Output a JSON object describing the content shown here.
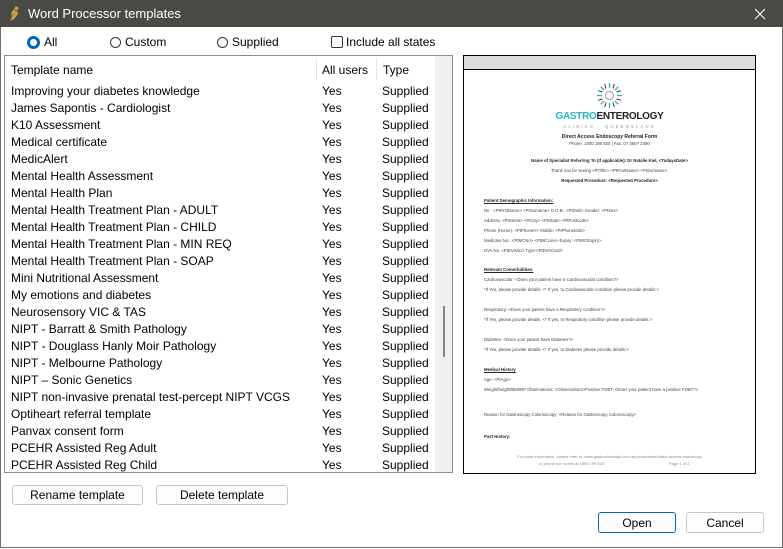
{
  "window": {
    "title": "Word Processor templates",
    "app_icon": "finch-bird-icon",
    "close_icon": "close-icon"
  },
  "filters": {
    "options": [
      {
        "label": "All",
        "checked": true
      },
      {
        "label": "Custom",
        "checked": false
      },
      {
        "label": "Supplied",
        "checked": false
      }
    ],
    "include_all_states": {
      "label": "Include all states",
      "checked": false
    }
  },
  "table": {
    "columns": [
      "Template name",
      "All users",
      "Type"
    ],
    "rows": [
      {
        "name": "Improving your diabetes knowledge",
        "all_users": "Yes",
        "type": "Supplied"
      },
      {
        "name": "James Sapontis - Cardiologist",
        "all_users": "Yes",
        "type": "Supplied"
      },
      {
        "name": "K10 Assessment",
        "all_users": "Yes",
        "type": "Supplied"
      },
      {
        "name": "Medical certificate",
        "all_users": "Yes",
        "type": "Supplied"
      },
      {
        "name": "MedicAlert",
        "all_users": "Yes",
        "type": "Supplied"
      },
      {
        "name": "Mental Health Assessment",
        "all_users": "Yes",
        "type": "Supplied"
      },
      {
        "name": "Mental Health Plan",
        "all_users": "Yes",
        "type": "Supplied"
      },
      {
        "name": "Mental Health Treatment Plan - ADULT",
        "all_users": "Yes",
        "type": "Supplied"
      },
      {
        "name": "Mental Health Treatment Plan - CHILD",
        "all_users": "Yes",
        "type": "Supplied"
      },
      {
        "name": "Mental Health Treatment Plan - MIN REQ",
        "all_users": "Yes",
        "type": "Supplied"
      },
      {
        "name": "Mental Health Treatment Plan - SOAP",
        "all_users": "Yes",
        "type": "Supplied"
      },
      {
        "name": "Mini Nutritional Assessment",
        "all_users": "Yes",
        "type": "Supplied"
      },
      {
        "name": "My emotions and diabetes",
        "all_users": "Yes",
        "type": "Supplied"
      },
      {
        "name": "Neurosensory VIC & TAS",
        "all_users": "Yes",
        "type": "Supplied"
      },
      {
        "name": "NIPT - Barratt & Smith Pathology",
        "all_users": "Yes",
        "type": "Supplied"
      },
      {
        "name": "NIPT - Douglass Hanly Moir Pathology",
        "all_users": "Yes",
        "type": "Supplied"
      },
      {
        "name": "NIPT - Melbourne Pathology",
        "all_users": "Yes",
        "type": "Supplied"
      },
      {
        "name": "NIPT – Sonic Genetics",
        "all_users": "Yes",
        "type": "Supplied"
      },
      {
        "name": "NIPT non-invasive prenatal test-percept NIPT VCGS",
        "all_users": "Yes",
        "type": "Supplied"
      },
      {
        "name": "Optiheart referral template",
        "all_users": "Yes",
        "type": "Supplied"
      },
      {
        "name": "Panvax consent form",
        "all_users": "Yes",
        "type": "Supplied"
      },
      {
        "name": "PCEHR Assisted Reg Adult",
        "all_users": "Yes",
        "type": "Supplied"
      },
      {
        "name": "PCEHR Assisted Reg Child",
        "all_users": "Yes",
        "type": "Supplied"
      }
    ]
  },
  "preview": {
    "logo_part1": "GASTRO",
    "logo_part2": "ENTEROLOGY",
    "logo_sub": "CLINICS · QUEENSLAND",
    "brand_color": "#2bb3c0",
    "form_title": "Direct Access Endoscopy Referral Form",
    "phone_line": "Phone: 1800 199 920 | Fax: 07 3607 2490",
    "specialist_line": "Name of Specialist Referring To (If applicable): Dr Natalie Kiel,  <TodaysDate>",
    "thank_you_line": "Thank you for seeing  <PtTitle> <PtFirstName> <PtSurname>.",
    "requested_line": "Requested Procedure: <Requested Procedure>",
    "demographic_heading": "Patient Demographic Information:",
    "demographic_lines": [
      "Re : <PtFirstName> <PtSurname>  D.O.B.: <PtDoB>   Gender: <PtSex>",
      "Address: <PtStreet> <PtCity> <PtState> <PtPostcode>",
      "Phone (Home): <PtPhoneH>   Mobile: <PtPhoneMob>",
      "Medicare No.: <PtMCNo> <PtMCLine> Expiry: <PtMCExpiry>",
      "DVA No: <PtDVANo> Type:<PtDVACard>"
    ],
    "comorbidities_heading": "Relevant Comorbidities:",
    "comorbidity_lines": [
      "Cardiovascular: <Does your patient have a Cardiovascular condition?>",
      "*If Yes, please provide details: <* If yes, to Cardiovascular condition please provide details:>",
      "Respiratory: <Does your patient have a Respiratory condition?>",
      "*If Yes, please provide details: <* If yes, to Respiratory condition please provide details:>",
      "Diabetes: <Does your patient have Diabetes?>",
      "*If Yes, please provide details: <* If yes, to Diabetes please provide details:>"
    ],
    "history_heading": "Medical History",
    "history_lines": [
      "Age: <PtAge>",
      "Weight/height/BMI/BP Observations: <Observations>Positive FOBT: <Does your patient have  a positive FOBT?>",
      "Reason for Gastroscopy Colonoscopy: <Reason for Gastroscopy Colonoscopy>",
      "Past History:"
    ],
    "footer_line1": "For more information, please refer to: www.gastroclinicsqld.com.au/procedures/direct-access-endoscopy",
    "footer_line2": "or phone our rooms at 1800 199 920",
    "footer_page": "Page 1 of 2"
  },
  "buttons": {
    "rename": "Rename template",
    "delete": "Delete template",
    "open": "Open",
    "cancel": "Cancel"
  }
}
